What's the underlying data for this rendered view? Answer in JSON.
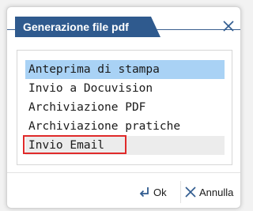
{
  "dialog": {
    "title": "Generazione file pdf"
  },
  "list": {
    "items": [
      {
        "label": "Anteprima di stampa"
      },
      {
        "label": "Invio a Docuvision"
      },
      {
        "label": "Archiviazione PDF"
      },
      {
        "label": "Archiviazione pratiche"
      },
      {
        "label": "Invio Email"
      }
    ],
    "selected_index": 0,
    "highlighted_index": 4
  },
  "buttons": {
    "ok_label": "Ok",
    "cancel_label": "Annulla"
  },
  "icons": {
    "close": "close-icon",
    "ok": "enter-arrow-icon",
    "cancel": "close-x-icon"
  },
  "colors": {
    "title_bg": "#2f5a8e",
    "selected_bg": "#a9d2f5",
    "highlight_border": "#e02a2a",
    "icon_blue": "#2f5a8e"
  }
}
